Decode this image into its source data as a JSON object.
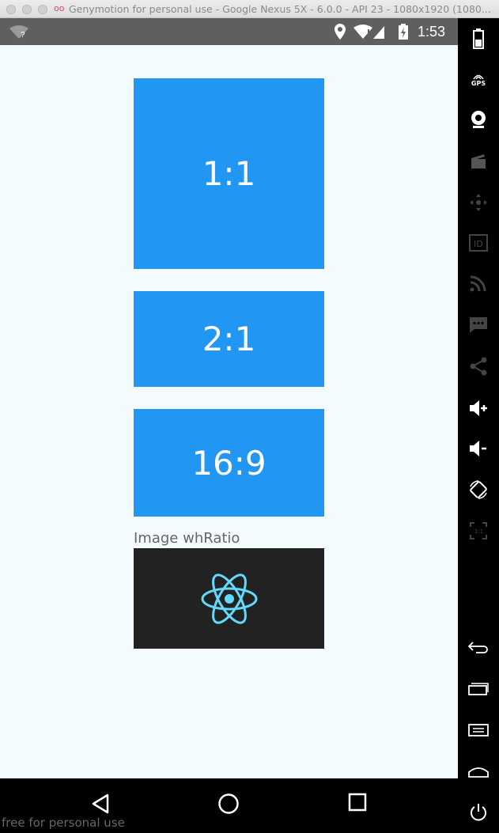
{
  "window": {
    "title": "Genymotion for personal use - Google Nexus 5X - 6.0.0 - API 23 - 1080x1920 (1080..."
  },
  "statusbar": {
    "time": "1:53",
    "icons": [
      "wifi-unknown-icon",
      "location-icon",
      "wifi-icon",
      "signal-icon",
      "battery-charging-icon"
    ]
  },
  "content": {
    "boxes": [
      {
        "label": "1:1"
      },
      {
        "label": "2:1"
      },
      {
        "label": "16:9"
      }
    ],
    "image_label": "Image whRatio",
    "image_icon": "react-logo-icon",
    "colors": {
      "box": "#2196f3",
      "image_bg": "#222222",
      "screen_bg": "#f4fbff",
      "react": "#61dafb"
    }
  },
  "navbar": {
    "buttons": [
      "back-icon",
      "home-icon",
      "recents-icon"
    ],
    "watermark": "free for personal use"
  },
  "sidebar": {
    "gps_label": "GPS",
    "id_label": "ID",
    "ratio_label": "1:1",
    "buttons": [
      "battery-icon",
      "gps-icon",
      "webcam-icon",
      "capture-icon",
      "remote-control-icon",
      "device-id-icon",
      "network-icon",
      "sms-icon",
      "share-icon",
      "volume-up-icon",
      "volume-down-icon",
      "rotate-icon",
      "pixel-perfect-icon",
      "back-icon",
      "recent-apps-icon",
      "menu-icon",
      "home-icon",
      "power-icon"
    ]
  }
}
